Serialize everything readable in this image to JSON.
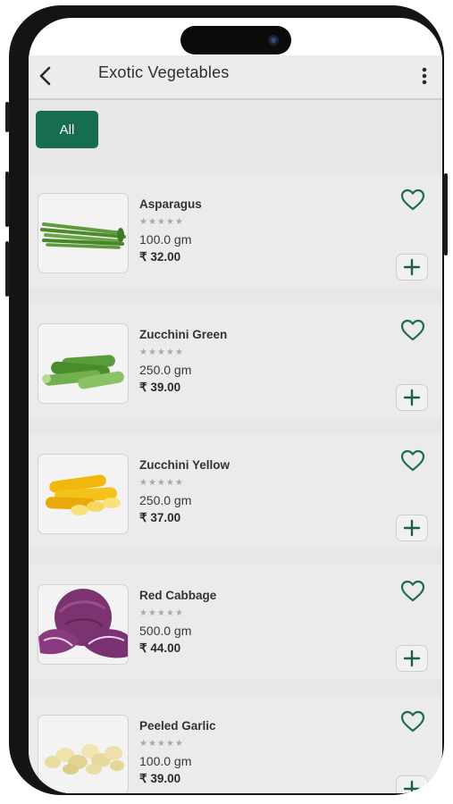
{
  "header": {
    "title": "Exotic Vegetables"
  },
  "filters": [
    {
      "label": "All",
      "selected": true
    }
  ],
  "currency_symbol": "₹",
  "products": [
    {
      "name": "Asparagus",
      "rating": "★★★★★",
      "weight": "100.0 gm",
      "price": "₹ 32.00",
      "image_icon": "asparagus-image"
    },
    {
      "name": "Zucchini Green",
      "rating": "★★★★★",
      "weight": "250.0 gm",
      "price": "₹ 39.00",
      "image_icon": "green-zucchini-image"
    },
    {
      "name": "Zucchini Yellow",
      "rating": "★★★★★",
      "weight": "250.0 gm",
      "price": "₹ 37.00",
      "image_icon": "yellow-zucchini-image"
    },
    {
      "name": "Red Cabbage",
      "rating": "★★★★★",
      "weight": "500.0 gm",
      "price": "₹ 44.00",
      "image_icon": "red-cabbage-image"
    },
    {
      "name": "Peeled Garlic",
      "rating": "★★★★★",
      "weight": "100.0 gm",
      "price": "₹ 39.00",
      "image_icon": "garlic-image"
    }
  ],
  "colors": {
    "accent": "#176d50",
    "background": "#e7e7e7",
    "appbar": "#ececec",
    "star": "#a9a9a9"
  },
  "icons": [
    "back-arrow-icon",
    "more-vertical-icon",
    "heart-icon",
    "plus-icon"
  ]
}
